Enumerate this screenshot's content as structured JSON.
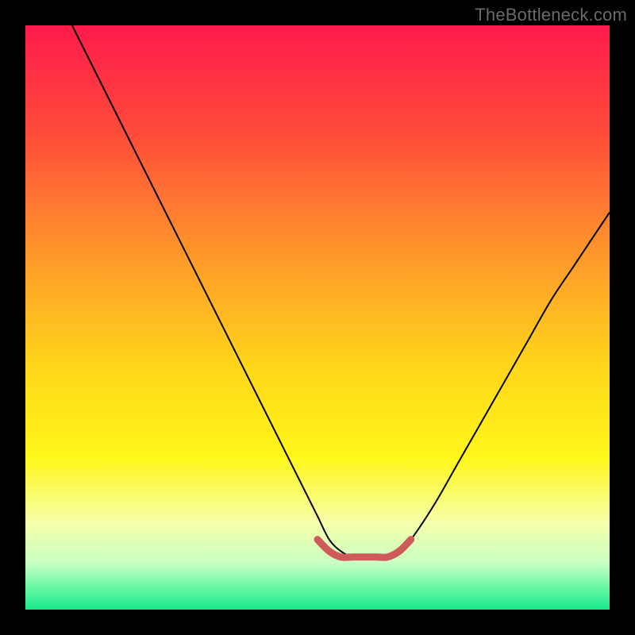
{
  "watermark": "TheBottleneck.com",
  "chart_data": {
    "type": "line",
    "title": "",
    "xlabel": "",
    "ylabel": "",
    "xlim": [
      0,
      100
    ],
    "ylim": [
      0,
      100
    ],
    "grid": false,
    "series": [
      {
        "name": "bottleneck-curve",
        "x": [
          8,
          12,
          16,
          20,
          24,
          28,
          32,
          36,
          40,
          44,
          48,
          50,
          52,
          54,
          56,
          58,
          60,
          62,
          64,
          66,
          70,
          74,
          78,
          82,
          86,
          90,
          94,
          98,
          100
        ],
        "y": [
          100,
          92,
          84,
          76,
          68,
          60,
          52,
          44,
          36,
          28,
          20,
          16,
          12,
          10,
          9,
          9,
          9,
          9,
          10,
          12,
          18,
          25,
          32,
          39,
          46,
          53,
          59,
          65,
          68
        ]
      },
      {
        "name": "optimal-band",
        "x": [
          50,
          52,
          54,
          56,
          58,
          60,
          62,
          64,
          66
        ],
        "y": [
          12,
          10,
          9,
          9,
          9,
          9,
          9,
          10,
          12
        ]
      }
    ],
    "background_gradient": {
      "stops": [
        {
          "pos": 0.0,
          "color": "#ff1a4c"
        },
        {
          "pos": 0.18,
          "color": "#ff4a3a"
        },
        {
          "pos": 0.4,
          "color": "#ff9a2a"
        },
        {
          "pos": 0.58,
          "color": "#ffd51a"
        },
        {
          "pos": 0.74,
          "color": "#fff71a"
        },
        {
          "pos": 0.85,
          "color": "#f6ffa8"
        },
        {
          "pos": 0.92,
          "color": "#c9ffc3"
        },
        {
          "pos": 0.96,
          "color": "#6cf7a6"
        },
        {
          "pos": 1.0,
          "color": "#18e98a"
        }
      ]
    },
    "optimal_band_style": {
      "stroke": "#cf5a5a",
      "width": 9
    },
    "curve_style": {
      "stroke": "#000000",
      "width": 2
    }
  }
}
